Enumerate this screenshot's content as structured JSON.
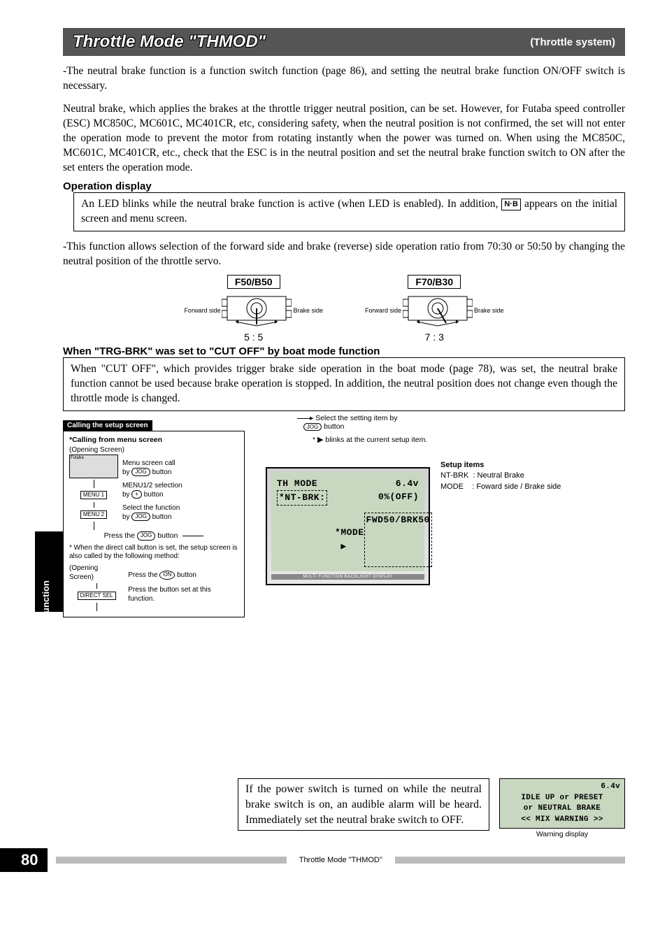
{
  "titlebar": {
    "title": "Throttle Mode \"THMOD\"",
    "right": "(Throttle system)"
  },
  "para1": "-The neutral brake function is a function switch function (page 86), and setting the neutral brake function ON/OFF switch is necessary.",
  "para2": "Neutral brake, which applies the brakes at the throttle trigger neutral position, can be set. However, for Futaba speed controller (ESC) MC850C, MC601C, MC401CR, etc, considering safety, when the neutral position is not confirmed, the set will not enter the operation mode to prevent the motor from rotating instantly when the power was turned on. When using the MC850C, MC601C, MC401CR, etc., check that the ESC is in the neutral position and set the neutral brake function switch to ON after the set enters the operation mode.",
  "op_display_heading": "Operation display",
  "op_display_body_a": "An LED blinks while the neutral brake function is active (when LED is enabled). In addition, ",
  "op_display_nb": "N·B",
  "op_display_body_b": " appears on the initial screen and menu screen.",
  "para3": "-This function allows selection of the forward side and brake (reverse) side operation ratio from 70:30 or 50:50 by changing the neutral position of the throttle servo.",
  "diagrams": {
    "left": {
      "title": "F50/B50",
      "forward": "Forward side",
      "brake": "Brake side",
      "ratio": "5 : 5"
    },
    "right": {
      "title": "F70/B30",
      "forward": "Forward side",
      "brake": "Brake side",
      "ratio": "7 : 3"
    }
  },
  "cutoff_heading": "When \"TRG-BRK\" was set to \"CUT OFF\" by boat mode function",
  "cutoff_body": "When \"CUT OFF\", which provides trigger brake side operation in the boat mode (page 78), was set, the neutral brake function cannot be used because brake operation is stopped. In addition, the neutral position does not change even though the throttle mode is changed.",
  "function_tab": "Function",
  "callbox": {
    "title": "Calling the setup screen",
    "from_menu": "*Calling from menu screen",
    "opening": "(Opening Screen)",
    "menu_call": "Menu screen call",
    "by_jog": "by",
    "jog": "JOG",
    "button_word": "button",
    "menu1": "MENU 1",
    "menu2": "MENU 2",
    "menu_sel": "MENU1/2 selection",
    "by_plus": "by",
    "plus": "+",
    "select_fn": "Select the function",
    "press_jog": "Press the",
    "direct_note": "* When the direct call button is set, the setup screen is also called by the following method:",
    "direct_sel": "DIRECT SEL",
    "press_set": "Press the button set at this function.",
    "press_on": "Press the",
    "on_btn": "ON"
  },
  "hint": {
    "line1": "Select the setting item by",
    "line2_a": "*",
    "line2_b": "blinks at the current setup item."
  },
  "lcd": {
    "row1_left": "TH MODE",
    "row1_right": "6.4v",
    "row2_left": "*NT-BRK:",
    "row2_right": "0%(OFF)",
    "row3_left": "*MODE",
    "row3_arrow": "▶",
    "row3_right": "FWD50/BRK50",
    "footer": "MULTI FUNCTION BACKLIGHT DISPLAY"
  },
  "setup_items": {
    "heading": "Setup items",
    "l1": "NT-BRK  : Neutral Brake",
    "l2": "MODE    : Foward side / Brake side"
  },
  "warn": {
    "text": "If the power switch is turned on while the neutral brake switch is on, an audible alarm will be heard. Immediately set the neutral brake switch to OFF.",
    "lcd_v": "6.4v",
    "lcd_l1": "IDLE UP or PRESET",
    "lcd_l2": "or NEUTRAL BRAKE",
    "lcd_l3": "<< MIX WARNING >>",
    "label": "Warning display"
  },
  "footer": {
    "page": "80",
    "text": "Throttle Mode \"THMOD\""
  }
}
